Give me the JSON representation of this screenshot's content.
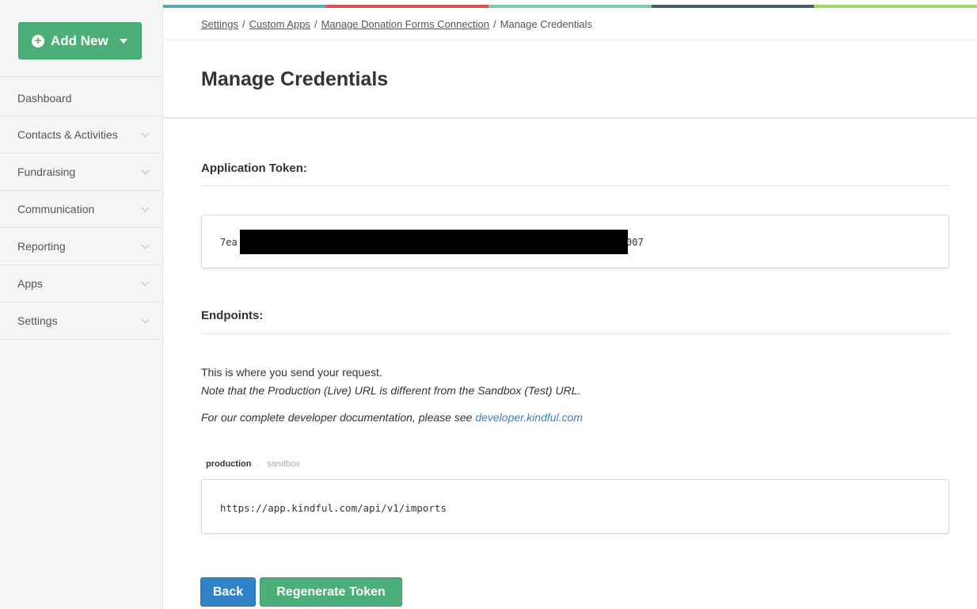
{
  "sidebar": {
    "add_new_label": "Add New",
    "items": [
      {
        "label": "Dashboard",
        "has_chevron": false
      },
      {
        "label": "Contacts & Activities",
        "has_chevron": true
      },
      {
        "label": "Fundraising",
        "has_chevron": true
      },
      {
        "label": "Communication",
        "has_chevron": true
      },
      {
        "label": "Reporting",
        "has_chevron": true
      },
      {
        "label": "Apps",
        "has_chevron": true
      },
      {
        "label": "Settings",
        "has_chevron": true
      }
    ]
  },
  "colorbar": [
    "#5aa7b7",
    "#d9534f",
    "#7ec8a9",
    "#435a6e",
    "#9ed36a"
  ],
  "breadcrumb": {
    "items": [
      "Settings",
      "Custom Apps",
      "Manage Donation Forms Connection"
    ],
    "current": "Manage Credentials"
  },
  "page": {
    "title": "Manage Credentials"
  },
  "token": {
    "label": "Application Token:",
    "prefix": "7ea",
    "suffix": "007",
    "redacted": true
  },
  "endpoints": {
    "label": "Endpoints:",
    "intro": "This is where you send your request.",
    "note": "Note that the Production (Live) URL is different from the Sandbox (Test) URL.",
    "docs_text": "For our complete developer documentation, please see ",
    "docs_link": "developer.kindful.com",
    "tabs": {
      "active": "production",
      "separator": "-",
      "inactive": "sandbox"
    },
    "url": "https://app.kindful.com/api/v1/imports"
  },
  "actions": {
    "back_label": "Back",
    "regenerate_label": "Regenerate Token"
  },
  "colors": {
    "green": "#4cae78",
    "blue": "#3182c8",
    "link": "#3f7fc1"
  }
}
